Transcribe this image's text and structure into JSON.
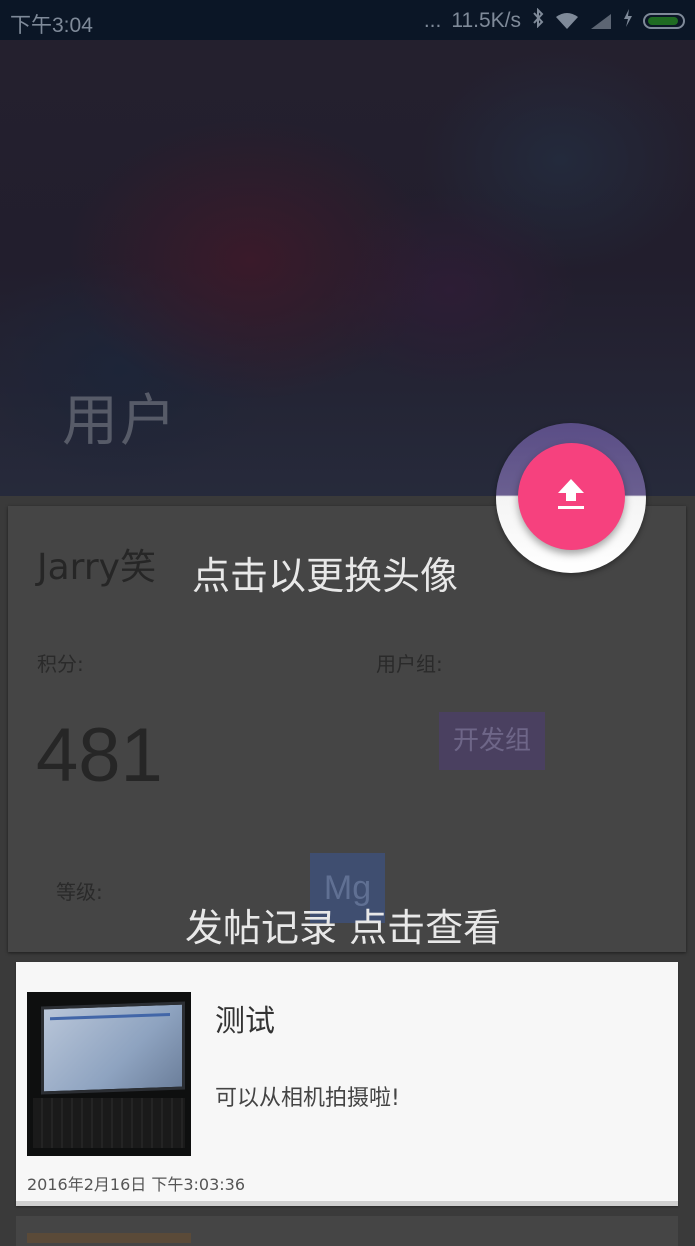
{
  "status_bar": {
    "time": "下午3:04",
    "dots": "...",
    "speed": "11.5K/s"
  },
  "header": {
    "title": "用户"
  },
  "fab": {
    "icon": "upload-icon",
    "color": "#f6417e"
  },
  "profile": {
    "username": "Jarry笑",
    "points_label": "积分:",
    "points_value": "481",
    "group_label": "用户组:",
    "group_value": "开发组",
    "level_label": "等级:",
    "level_value": "Mg"
  },
  "hints": {
    "avatar": "点击以更换头像",
    "posts": "发帖记录  点击查看"
  },
  "posts": [
    {
      "title": "测试",
      "body": "可以从相机拍摄啦!",
      "date": "2016年2月16日 下午3:03:36"
    }
  ]
}
